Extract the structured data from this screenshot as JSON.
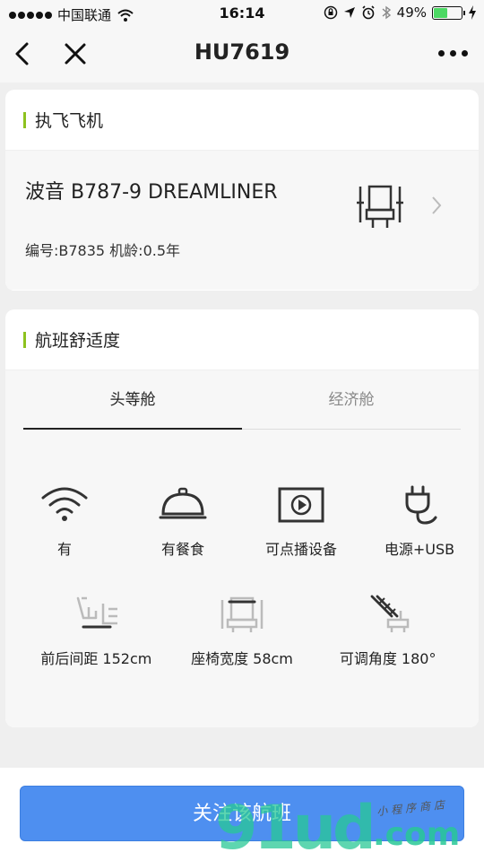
{
  "status_bar": {
    "carrier": "中国联通",
    "time": "16:14",
    "battery": "49%",
    "battery_level": 0.49
  },
  "nav": {
    "title": "HU7619"
  },
  "aircraft_card": {
    "header": "执飞飞机",
    "model": "波音 B787-9 DREAMLINER",
    "meta": "编号:B7835 机龄:0.5年"
  },
  "comfort_card": {
    "header": "航班舒适度",
    "tabs": [
      {
        "label": "头等舱",
        "active": true
      },
      {
        "label": "经济舱",
        "active": false
      }
    ],
    "amenities": [
      {
        "icon": "wifi-icon",
        "label": "有"
      },
      {
        "icon": "meal-cloche-icon",
        "label": "有餐食"
      },
      {
        "icon": "video-play-icon",
        "label": "可点播设备"
      },
      {
        "icon": "power-plug-icon",
        "label": "电源+USB"
      }
    ],
    "specs": [
      {
        "icon": "seat-pitch-icon",
        "label": "前后间距 152cm"
      },
      {
        "icon": "seat-width-icon",
        "label": "座椅宽度 58cm"
      },
      {
        "icon": "seat-recline-icon",
        "label": "可调角度 180°"
      }
    ]
  },
  "bottom": {
    "follow_label": "关注该航班"
  },
  "watermark": {
    "main": "91ud",
    "suffix": ".com",
    "small": "小程序商店"
  },
  "colors": {
    "accent": "#8dc21f",
    "button": "#4e8ff0",
    "battery": "#4cd964"
  }
}
